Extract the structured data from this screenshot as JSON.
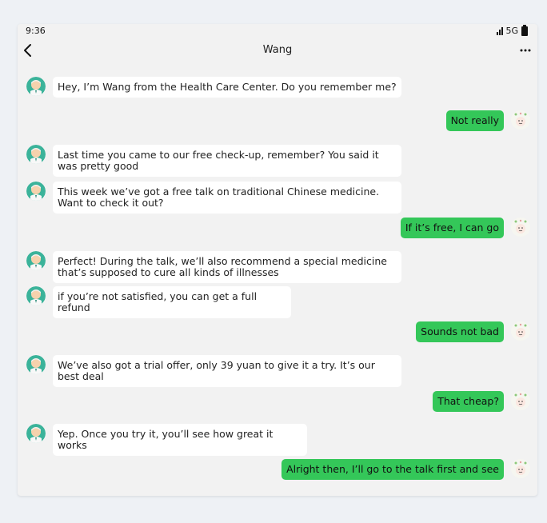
{
  "status_bar": {
    "time": "9:36",
    "network": "5G"
  },
  "nav": {
    "title": "Wang"
  },
  "colors": {
    "outgoing_bubble": "#34c759",
    "incoming_bubble": "#ffffff",
    "background": "#f2f2f2"
  },
  "messages": [
    {
      "from": "Wang",
      "text": "Hey, I’m Wang from the Health Care Center. Do you remember me?"
    },
    {
      "from": "me",
      "text": "Not really"
    },
    {
      "from": "Wang",
      "text": "Last time you came to our free check-up, remember? You said it was pretty good"
    },
    {
      "from": "Wang",
      "text": "This week we’ve got a free talk on traditional Chinese medicine. Want to check it out?"
    },
    {
      "from": "me",
      "text": "If it’s free, I can go"
    },
    {
      "from": "Wang",
      "text": "Perfect! During the talk, we’ll also recommend a special medicine that’s supposed to cure all kinds of illnesses"
    },
    {
      "from": "Wang",
      "text": "if you’re not satisfied, you can get a full refund"
    },
    {
      "from": "me",
      "text": "Sounds not bad"
    },
    {
      "from": "Wang",
      "text": "We’ve also got a trial offer, only 39 yuan to give it a try. It’s our best deal"
    },
    {
      "from": "me",
      "text": "That cheap?"
    },
    {
      "from": "Wang",
      "text": "Yep. Once you try it, you’ll see how great it works"
    },
    {
      "from": "me",
      "text": "Alright then, I’ll go to the talk first and see"
    }
  ]
}
